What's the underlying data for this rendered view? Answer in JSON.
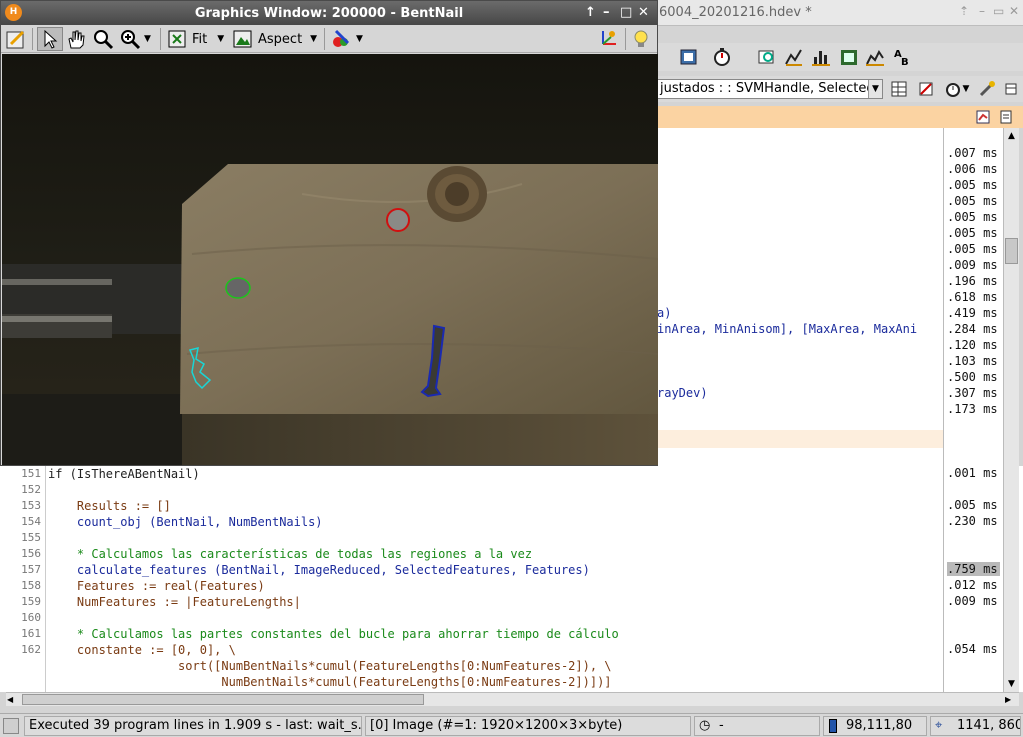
{
  "main_window": {
    "title": "6004_20201216.hdev *",
    "combo_value": "justados : : SVMHandle, Selected",
    "upper_code_lines": [
      "a)",
      "inArea, MinAnisom], [MaxArea, MaxAni",
      "rayDev)"
    ]
  },
  "graphics_window": {
    "title": "Graphics Window: 200000 - BentNail",
    "logo": "H",
    "toolbar": {
      "fit_label": "Fit",
      "aspect_label": "Aspect"
    },
    "controls": {
      "pin": "↑",
      "minimize": "–",
      "maximize": "□",
      "close": "✕"
    }
  },
  "editor": {
    "lines": [
      {
        "n": "151",
        "text": "if (IsThereABentNail)",
        "time": ".001 ms"
      },
      {
        "n": "152",
        "text": "",
        "time": ""
      },
      {
        "n": "153",
        "text": "    Results := []",
        "time": ".005 ms"
      },
      {
        "n": "154",
        "text": "    count_obj (BentNail, NumBentNails)",
        "time": ".230 ms"
      },
      {
        "n": "155",
        "text": "",
        "time": ""
      },
      {
        "n": "156",
        "text": "    * Calculamos las características de todas las regiones a la vez",
        "time": ""
      },
      {
        "n": "157",
        "text": "    calculate_features (BentNail, ImageReduced, SelectedFeatures, Features)",
        "time": ".759 ms"
      },
      {
        "n": "158",
        "text": "    Features := real(Features)",
        "time": ".012 ms"
      },
      {
        "n": "159",
        "text": "    NumFeatures := |FeatureLengths|",
        "time": ".009 ms"
      },
      {
        "n": "160",
        "text": "",
        "time": ""
      },
      {
        "n": "161",
        "text": "    * Calculamos las partes constantes del bucle para ahorrar tiempo de cálculo",
        "time": ""
      },
      {
        "n": "162",
        "text": "    constante := [0, 0], \\",
        "time": ".054 ms"
      },
      {
        "n": "",
        "text": "                  sort([NumBentNails*cumul(FeatureLengths[0:NumFeatures-2]), \\",
        "time": ""
      },
      {
        "n": "",
        "text": "                        NumBentNails*cumul(FeatureLengths[0:NumFeatures-2])])]",
        "time": ""
      }
    ],
    "upper_times": [
      ".007 ms",
      ".006 ms",
      ".005 ms",
      ".005 ms",
      ".005 ms",
      ".005 ms",
      ".005 ms",
      ".009 ms",
      ".196 ms",
      ".618 ms",
      ".419 ms",
      ".284 ms",
      ".120 ms",
      ".103 ms",
      ".500 ms",
      ".307 ms",
      ".173 ms"
    ]
  },
  "status_bar": {
    "message": "Executed 39 program lines in 1.909 s - last: wait_s...",
    "image_info": "[0] Image (#=1: 1920×1200×3×byte)",
    "timer": "-",
    "pixel_value": "98,111,80",
    "coords": "1141, 860"
  },
  "colors": {
    "accent_orange": "#fbd3a2",
    "title_bar": "#555555",
    "region_red": "#d01010",
    "region_green": "#1cc41c",
    "region_blue": "#1a2ab0",
    "region_cyan": "#19d6d6"
  }
}
